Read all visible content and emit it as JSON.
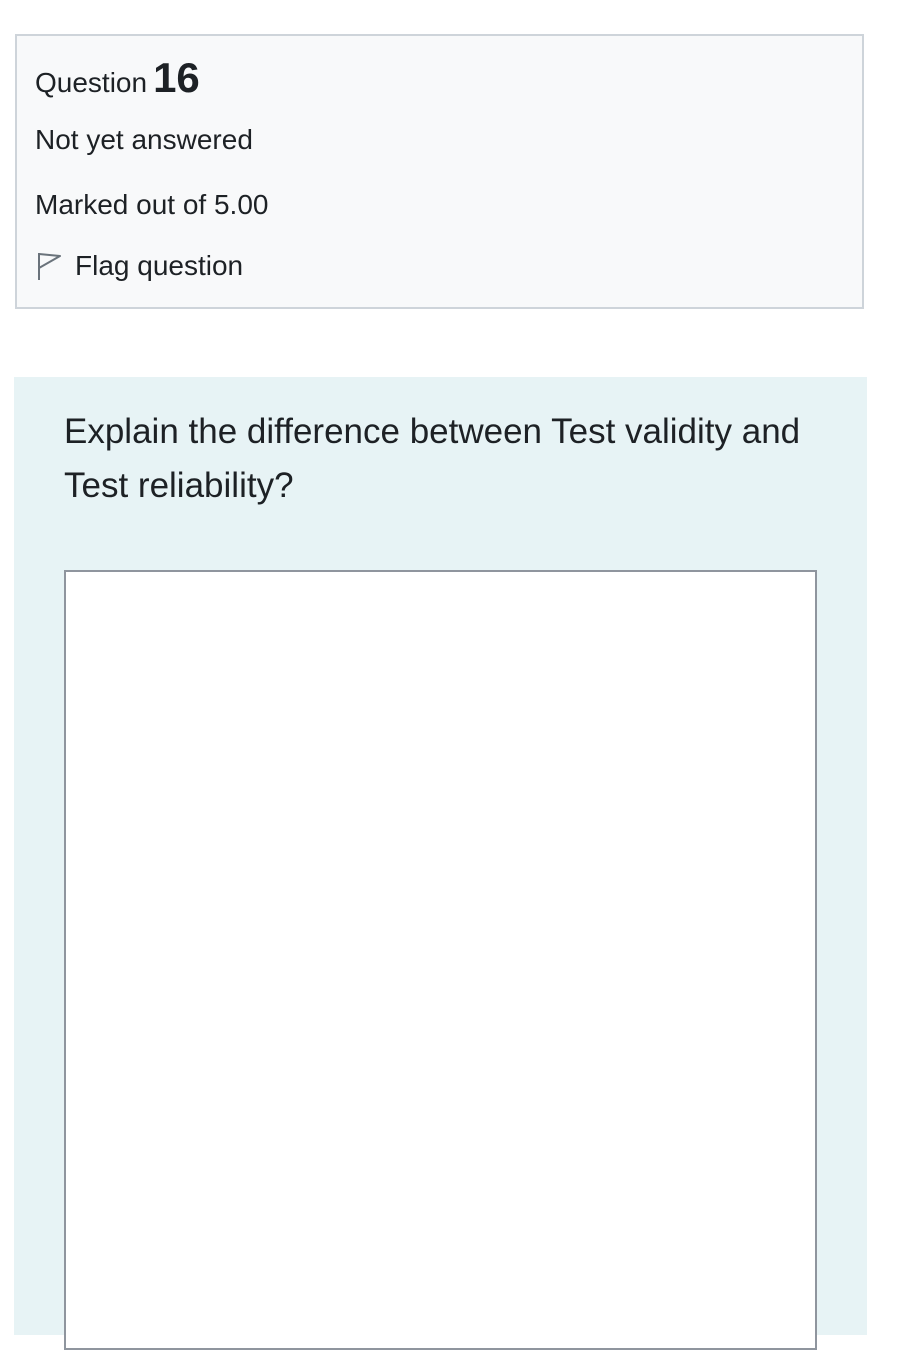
{
  "question_info": {
    "label": "Question",
    "number": "16",
    "state": "Not yet answered",
    "grade": "Marked out of 5.00",
    "flag_label": "Flag question"
  },
  "question": {
    "text": "Explain the difference between Test validity and Test reliability?",
    "answer_value": ""
  },
  "icons": {
    "flag": "flag-icon"
  },
  "colors": {
    "info_background": "#f8f9fa",
    "info_border": "#ced4da",
    "formulation_background": "#e7f3f5",
    "answer_border": "#8f959e",
    "text": "#1d2125"
  }
}
